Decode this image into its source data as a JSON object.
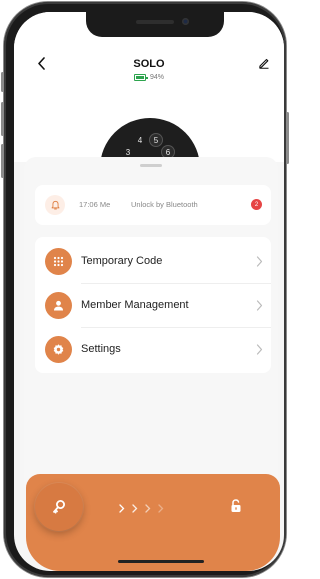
{
  "header": {
    "title": "SOLO",
    "battery_percent": "94%",
    "battery_level": 0.94
  },
  "lock_keypad": {
    "keys": [
      "4",
      "5",
      "3",
      "6"
    ]
  },
  "notification": {
    "time": "17:06 Me",
    "message": "Unlock by Bluetooth",
    "badge_count": "2"
  },
  "menu": {
    "items": [
      {
        "label": "Temporary Code",
        "icon": "keypad-icon"
      },
      {
        "label": "Member Management",
        "icon": "person-icon"
      },
      {
        "label": "Settings",
        "icon": "gear-icon"
      }
    ]
  },
  "colors": {
    "accent": "#e0844a",
    "battery": "#2da44e",
    "badge": "#e64545"
  }
}
